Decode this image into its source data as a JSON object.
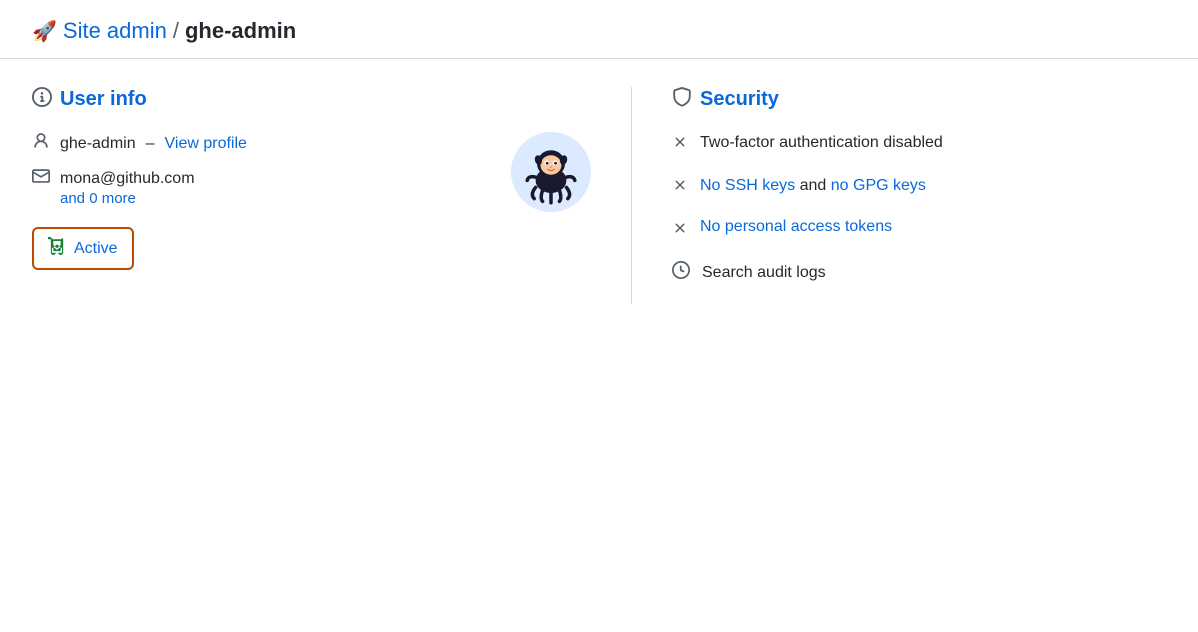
{
  "header": {
    "rocket_icon": "🚀",
    "site_admin_label": "Site admin",
    "separator": "/",
    "current_page": "ghe-admin"
  },
  "user_info": {
    "section_title": "User info",
    "info_icon": "ℹ",
    "username": "ghe-admin",
    "dash": "–",
    "view_profile_label": "View profile",
    "email": "mona@github.com",
    "email_more_label": "and 0 more",
    "active_label": "Active"
  },
  "security": {
    "section_title": "Security",
    "shield_icon": "shield",
    "two_factor_label": "Two-factor authentication disabled",
    "ssh_gpg_text_1": "No SSH keys",
    "ssh_gpg_and": "and",
    "ssh_gpg_text_2": "no GPG keys",
    "personal_tokens_label": "No personal access tokens",
    "audit_logs_label": "Search audit logs"
  }
}
